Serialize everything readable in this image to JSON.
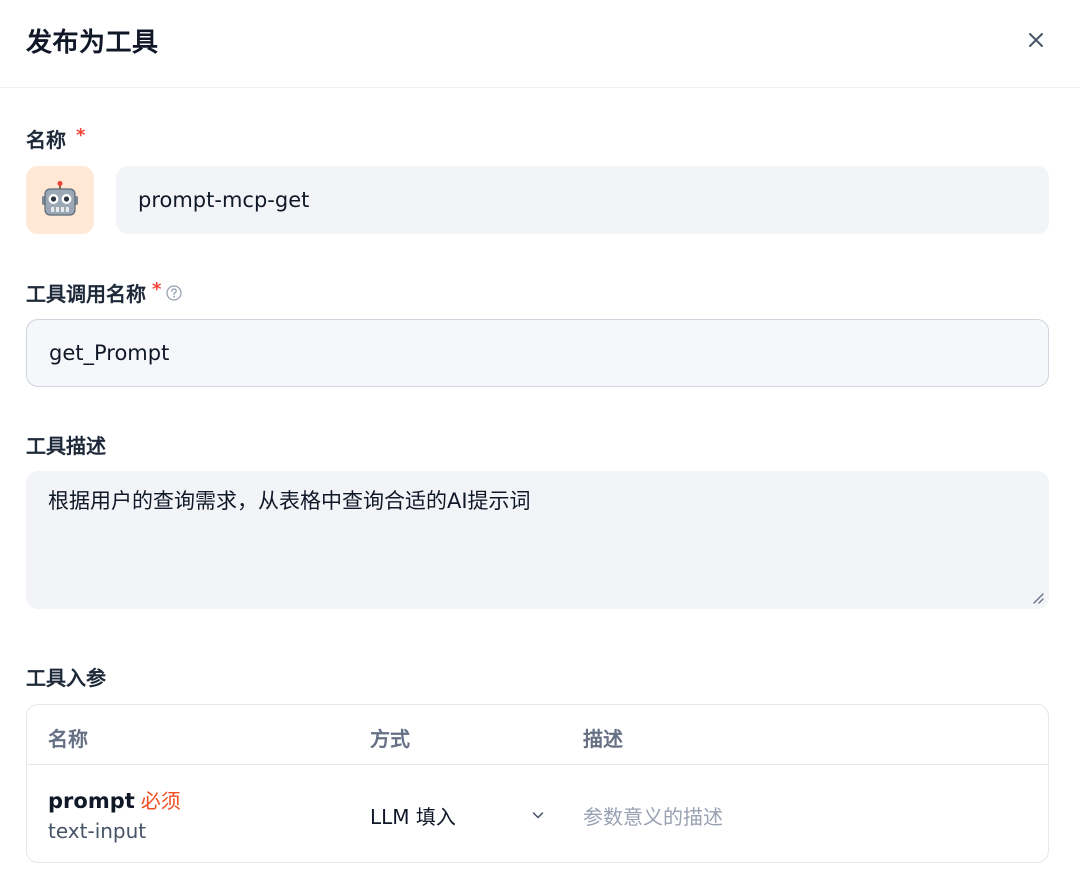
{
  "dialog": {
    "title": "发布为工具",
    "close_icon": "close-icon"
  },
  "name_field": {
    "label": "名称",
    "required_mark": "*",
    "avatar_icon": "robot-icon",
    "value": "prompt-mcp-get"
  },
  "call_name_field": {
    "label": "工具调用名称",
    "required_mark": "*",
    "help_icon": "question-circle-icon",
    "value": "get_Prompt"
  },
  "description_field": {
    "label": "工具描述",
    "value": "根据用户的查询需求，从表格中查询合适的AI提示词"
  },
  "params_section": {
    "label": "工具入参",
    "columns": [
      "名称",
      "方式",
      "描述"
    ],
    "rows": [
      {
        "name": "prompt",
        "required_label": "必须",
        "type": "text-input",
        "method": "LLM 填入",
        "description_placeholder": "参数意义的描述"
      }
    ]
  },
  "colors": {
    "required_star": "#f04438",
    "required_tag": "#f04e23",
    "avatar_bg": "#ffe8d6",
    "input_bg": "#f2f4f7"
  }
}
